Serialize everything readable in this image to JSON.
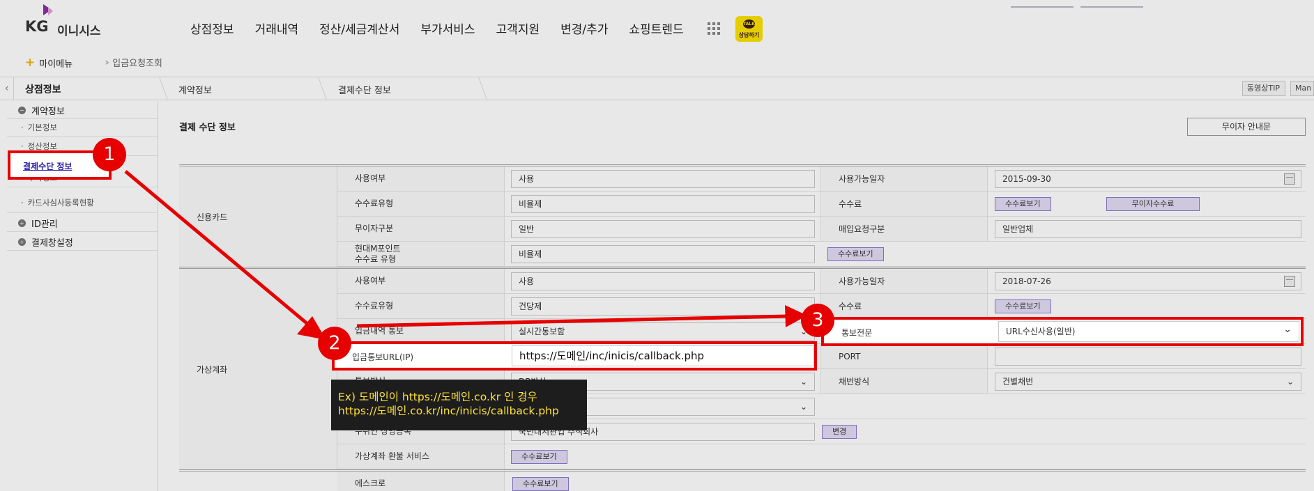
{
  "header": {
    "logo_kg": "KG",
    "logo_name": "이니시스",
    "gnb": [
      "상점정보",
      "거래내역",
      "정산/세금계산서",
      "부가서비스",
      "고객지원",
      "변경/추가",
      "쇼핑트렌드"
    ],
    "talk_bubble": "TALK",
    "talk_label": "상담하기"
  },
  "subbar": {
    "mymenu": "마이메뉴",
    "shortcut": "입금요청조회"
  },
  "crumbs": {
    "section": "상점정보",
    "level1": "계약정보",
    "level2": "결제수단 정보",
    "video_tip": "동영상TIP",
    "manual": "Man"
  },
  "sidebar": {
    "group1": "계약정보",
    "items": [
      "기본정보",
      "정산정보",
      "결제수단 정보",
      "부가정보",
      "카드사심사등록현황"
    ],
    "group2": "ID관리",
    "group3": "결제창설정"
  },
  "main": {
    "title": "결제 수단 정보",
    "guide_button": "무이자 안내문",
    "card": {
      "category": "신용카드",
      "use_label": "사용여부",
      "use_value": "사용",
      "fee_type_label": "수수료유형",
      "fee_type_value": "비율제",
      "noint_label": "무이자구분",
      "noint_value": "일반",
      "point_label_1": "현대M포인트",
      "point_label_2": "수수료 유형",
      "point_value": "비율제",
      "avail_label": "사용가능일자",
      "avail_value": "2015-09-30",
      "fee_label": "수수료",
      "fee_btn": "수수료보기",
      "noint_fee_btn": "무이자수수료",
      "buy_label": "매입요청구분",
      "buy_value": "일반업체",
      "point_fee_btn": "수수료보기"
    },
    "vacct": {
      "category": "가상계좌",
      "use_label": "사용여부",
      "use_value": "사용",
      "fee_type_label": "수수료유형",
      "fee_type_value": "건당제",
      "notify_label": "입금내역 통보",
      "notify_value": "실시간통보함",
      "url_label": "입금통보URL(IP)",
      "url_value": "https://도메인/inc/inicis/callback.php",
      "method_label": "통보방식",
      "method_value": "DB방식",
      "refund_label": "가상계좌 환불 서비스",
      "refund_btn": "수수료보기",
      "holder_label": "수취인 상명등록",
      "holder_value": "국민대서관업 주식회사",
      "holder_btn": "변경",
      "avail_label": "사용가능일자",
      "avail_value": "2018-07-26",
      "fee_label": "수수료",
      "fee_btn": "수수료보기",
      "msg_label": "통보전문",
      "msg_value": "URL수신사용(일반)",
      "port_label": "PORT",
      "numbering_label": "채번방식",
      "numbering_value": "건별채번"
    },
    "escrow": {
      "category": "에스크로",
      "fee_btn": "수수료보기"
    }
  },
  "annotations": {
    "badge1": "1",
    "badge2": "2",
    "badge3": "3",
    "tip_line1": "Ex) 도메인이 https://도메인.co.kr 인 경우",
    "tip_line2": "https://도메인.co.kr/inc/inicis/callback.php"
  },
  "colors": {
    "highlight": "#e60000",
    "button_fill": "#e3dcf6",
    "tip_text": "#ffe23a"
  }
}
